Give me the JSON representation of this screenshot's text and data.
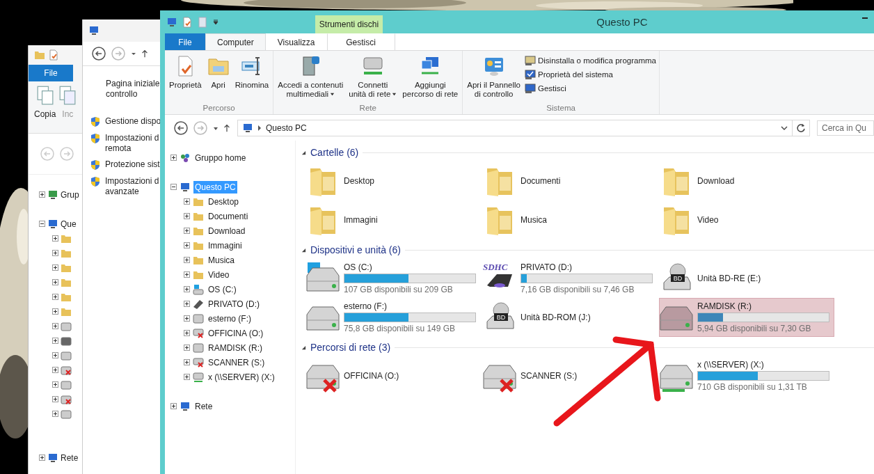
{
  "back_window_1": {
    "tab": "File",
    "commands": [
      {
        "label": "Copia",
        "disabled": false
      },
      {
        "label": "Inc",
        "disabled": true
      }
    ],
    "tree": [
      {
        "label": "Grup",
        "kind": "homegroup",
        "expanded": false
      },
      {
        "label": "Que",
        "kind": "computer",
        "expanded": true,
        "children": [
          {
            "kind": "folder"
          },
          {
            "kind": "folder"
          },
          {
            "kind": "folder"
          },
          {
            "kind": "folder"
          },
          {
            "kind": "folder"
          },
          {
            "kind": "folder"
          },
          {
            "kind": "system"
          },
          {
            "kind": "sd"
          },
          {
            "kind": "disk"
          },
          {
            "kind": "network",
            "disconnected": true
          },
          {
            "kind": "disk"
          },
          {
            "kind": "network",
            "disconnected": true
          },
          {
            "kind": "network",
            "disconnected": false
          }
        ]
      },
      {
        "label": "Rete",
        "kind": "network-root",
        "expanded": false
      }
    ]
  },
  "back_window_2": {
    "home_link": [
      "Pagina iniziale",
      "controllo"
    ],
    "links": [
      {
        "lines": [
          "Gestione dispo"
        ]
      },
      {
        "lines": [
          "Impostazioni d",
          "remota"
        ]
      },
      {
        "lines": [
          "Protezione sist"
        ]
      },
      {
        "lines": [
          "Impostazioni d",
          "avanzate"
        ]
      }
    ]
  },
  "window": {
    "title": "Questo PC",
    "context_group": "Strumenti dischi",
    "tabs": [
      {
        "label": "File",
        "kind": "file",
        "selected": false
      },
      {
        "label": "Computer",
        "kind": "tab",
        "selected": true
      },
      {
        "label": "Visualizza",
        "kind": "tab",
        "selected": false
      },
      {
        "label": "Gestisci",
        "kind": "context",
        "selected": false
      }
    ],
    "ribbon": [
      {
        "label": "Percorso",
        "buttons": [
          {
            "lines": [
              "Proprietà"
            ],
            "dropdown": false
          },
          {
            "lines": [
              "Apri"
            ],
            "dropdown": false
          },
          {
            "lines": [
              "Rinomina"
            ],
            "dropdown": false
          }
        ]
      },
      {
        "label": "Rete",
        "buttons": [
          {
            "lines": [
              "Accedi a contenuti",
              "multimediali"
            ],
            "dropdown": true
          },
          {
            "lines": [
              "Connetti",
              "unità di rete"
            ],
            "dropdown": true
          },
          {
            "lines": [
              "Aggiungi",
              "percorso di rete"
            ],
            "dropdown": false
          }
        ]
      },
      {
        "label": "Sistema",
        "buttons": [
          {
            "lines": [
              "Apri il Pannello",
              "di controllo"
            ],
            "dropdown": false
          }
        ],
        "small_buttons": [
          "Disinstalla o modifica programma",
          "Proprietà del sistema",
          "Gestisci"
        ]
      }
    ],
    "address": {
      "path": "Questo PC"
    },
    "search": {
      "placeholder": "Cerca in Qu"
    },
    "nav_tree": [
      {
        "label": "Gruppo home",
        "kind": "homegroup",
        "expanded": false,
        "selected": false
      },
      {
        "label": "Questo PC",
        "kind": "computer",
        "expanded": true,
        "selected": true,
        "children": [
          {
            "label": "Desktop",
            "kind": "folder",
            "expanded": false,
            "selected": false
          },
          {
            "label": "Documenti",
            "kind": "folder",
            "expanded": false,
            "selected": false
          },
          {
            "label": "Download",
            "kind": "folder",
            "expanded": false,
            "selected": false
          },
          {
            "label": "Immagini",
            "kind": "folder",
            "expanded": false,
            "selected": false
          },
          {
            "label": "Musica",
            "kind": "folder",
            "expanded": false,
            "selected": false
          },
          {
            "label": "Video",
            "kind": "folder",
            "expanded": false,
            "selected": false
          },
          {
            "label": "OS (C:)",
            "kind": "system",
            "expanded": false,
            "selected": false
          },
          {
            "label": "PRIVATO (D:)",
            "kind": "sd",
            "expanded": false,
            "selected": false
          },
          {
            "label": "esterno (F:)",
            "kind": "disk",
            "expanded": false,
            "selected": false
          },
          {
            "label": "OFFICINA (O:)",
            "kind": "network",
            "disconnected": true,
            "expanded": false,
            "selected": false
          },
          {
            "label": "RAMDISK (R:)",
            "kind": "disk",
            "expanded": false,
            "selected": false
          },
          {
            "label": "SCANNER (S:)",
            "kind": "network",
            "disconnected": true,
            "expanded": false,
            "selected": false
          },
          {
            "label": "x (\\\\SERVER) (X:)",
            "kind": "network",
            "disconnected": false,
            "expanded": false,
            "selected": false
          }
        ]
      },
      {
        "label": "Rete",
        "kind": "network-root",
        "expanded": false,
        "selected": false
      }
    ],
    "sections": [
      {
        "title": "Cartelle (6)",
        "expanded": true,
        "items": [
          {
            "name": "Desktop",
            "kind": "folder",
            "selected": false
          },
          {
            "name": "Documenti",
            "kind": "folder",
            "selected": false
          },
          {
            "name": "Download",
            "kind": "folder",
            "selected": false
          },
          {
            "name": "Immagini",
            "kind": "folder",
            "selected": false
          },
          {
            "name": "Musica",
            "kind": "folder",
            "selected": false
          },
          {
            "name": "Video",
            "kind": "folder",
            "selected": false
          }
        ]
      },
      {
        "title": "Dispositivi e unità (6)",
        "expanded": true,
        "items": [
          {
            "name": "OS (C:)",
            "kind": "system",
            "level": 0.49,
            "free": "107 GB disponibili su 209 GB",
            "selected": false
          },
          {
            "name": "PRIVATO (D:)",
            "kind": "sd",
            "badge": "SDHC",
            "level": 0.04,
            "free": "7,16 GB disponibili su 7,46 GB",
            "selected": false
          },
          {
            "name": "Unità BD-RE (E:)",
            "kind": "optical",
            "badge": "BD",
            "selected": false
          },
          {
            "name": "esterno (F:)",
            "kind": "disk",
            "level": 0.49,
            "free": "75,8 GB disponibili su 149 GB",
            "selected": false
          },
          {
            "name": "Unità BD-ROM (J:)",
            "kind": "optical",
            "badge": "BD",
            "selected": false
          },
          {
            "name": "RAMDISK (R:)",
            "kind": "disk",
            "level": 0.19,
            "free": "5,94 GB disponibili su 7,30 GB",
            "selected": true
          }
        ]
      },
      {
        "title": "Percorsi di rete (3)",
        "expanded": true,
        "items": [
          {
            "name": "OFFICINA (O:)",
            "kind": "network",
            "disconnected": true,
            "selected": false
          },
          {
            "name": "SCANNER (S:)",
            "kind": "network",
            "disconnected": true,
            "selected": false
          },
          {
            "name": "x (\\\\SERVER) (X:)",
            "kind": "network",
            "disconnected": false,
            "level": 0.46,
            "free": "710 GB disponibili su 1,31 TB",
            "selected": false
          }
        ]
      }
    ]
  }
}
